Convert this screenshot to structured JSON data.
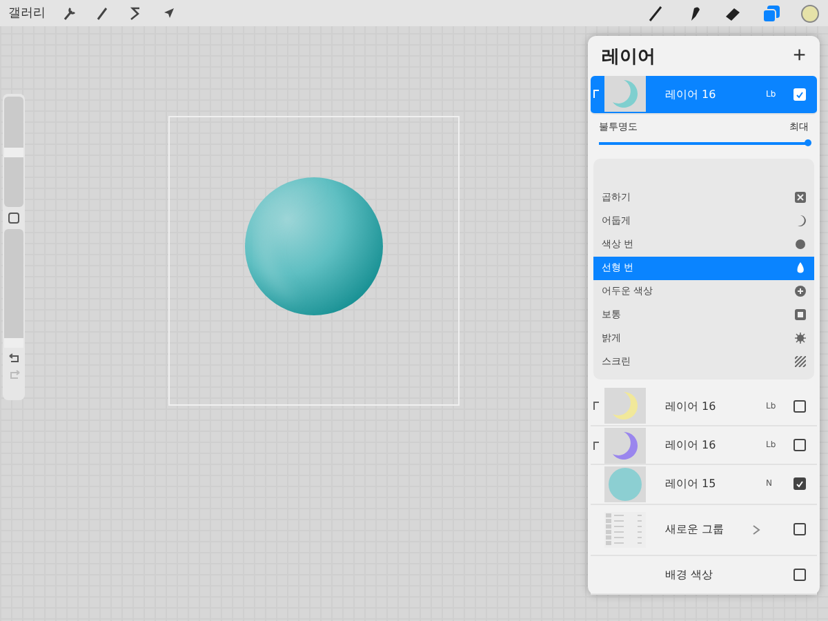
{
  "topbar": {
    "gallery": "갤러리"
  },
  "sidebar": {
    "brush_size": {
      "level": 0.5
    },
    "brush_opacity": {
      "level": 0
    }
  },
  "panel": {
    "title": "레이어",
    "add": "+"
  },
  "selected_layer": {
    "name": "레이어 16",
    "blend": "Lb",
    "visible": true,
    "clipped": true,
    "kind": "crescent",
    "color": "#7fcfcf"
  },
  "opacity": {
    "label": "불투명도",
    "value": "최대",
    "level": 1
  },
  "blend_modes": [
    {
      "name": "곱하기",
      "selected": false,
      "kind": "multiply"
    },
    {
      "name": "어둡게",
      "selected": false,
      "kind": "moon"
    },
    {
      "name": "색상 번",
      "selected": false,
      "kind": "burn"
    },
    {
      "name": "선형 번",
      "selected": true,
      "kind": "flame"
    },
    {
      "name": "어두운 색상",
      "selected": false,
      "kind": "plus"
    },
    {
      "name": "보통",
      "selected": false,
      "kind": "normal"
    },
    {
      "name": "밝게",
      "selected": false,
      "kind": "sun"
    },
    {
      "name": "스크린",
      "selected": false,
      "kind": "screen"
    }
  ],
  "layers": [
    {
      "name": "레이어 16",
      "blend": "Lb",
      "visible": false,
      "clipped": true,
      "kind": "crescent",
      "color": "#f1e89a"
    },
    {
      "name": "레이어 16",
      "blend": "Lb",
      "visible": false,
      "clipped": true,
      "kind": "crescent",
      "color": "#9a86ee"
    },
    {
      "name": "레이어 15",
      "blend": "N",
      "visible": true,
      "clipped": false,
      "kind": "circle",
      "color": "#8ccfd2"
    },
    {
      "name": "새로운 그룹",
      "visible": false,
      "clipped": false,
      "kind": "group"
    },
    {
      "name": "배경 색상",
      "visible": false,
      "clipped": false,
      "kind": "background"
    }
  ]
}
